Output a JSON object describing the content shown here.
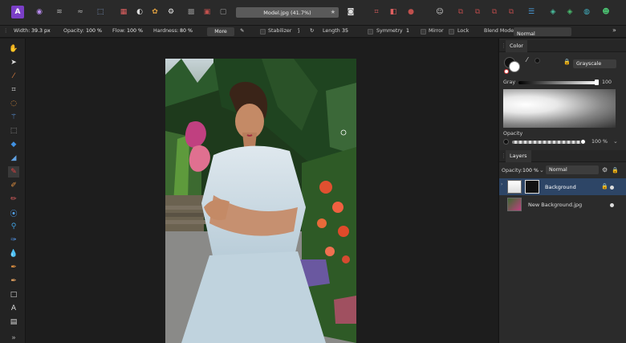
{
  "topbar": {
    "document_title": "Model.jpg (41.7%)",
    "star_icon": "★"
  },
  "context": {
    "width_label": "Width:",
    "width_value": "39.3 px",
    "opacity_label": "Opacity:",
    "opacity_value": "100 %",
    "flow_label": "Flow:",
    "flow_value": "100 %",
    "hardness_label": "Hardness:",
    "hardness_value": "80 %",
    "more_label": "More",
    "stabilizer_label": "Stabilizer",
    "length_label": "Length",
    "length_value": "35",
    "symmetry_label": "Symmetry",
    "symmetry_value": "1",
    "mirror_label": "Mirror",
    "lock_label": "Lock",
    "blend_mode_label": "Blend Mode:",
    "blend_mode_value": "Normal"
  },
  "color_panel": {
    "tab_label": "Color",
    "mode_value": "Grayscale",
    "gray_label": "Gray",
    "gray_value": "100",
    "opacity_label": "Opacity",
    "opacity_value": "100 %"
  },
  "layers_panel": {
    "tab_label": "Layers",
    "opacity_label": "Opacity:",
    "opacity_value": "100 %",
    "blend_value": "Normal",
    "layers": [
      {
        "name": "Background"
      },
      {
        "name": "New Background.jpg"
      }
    ]
  },
  "colors": {
    "accent_purple": "#6b2fb8",
    "selection_blue": "#2d4566"
  }
}
